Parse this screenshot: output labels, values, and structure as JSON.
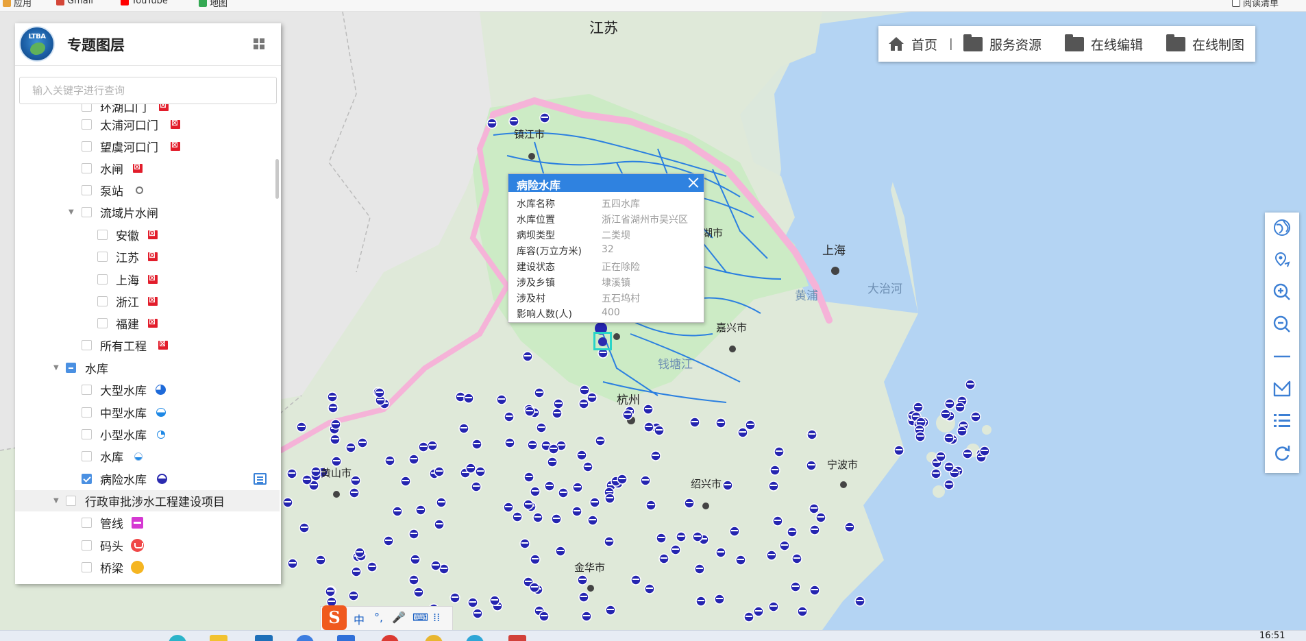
{
  "browser": {
    "bookmarks": [
      "应用",
      "Gmail",
      "YouTube",
      "地图"
    ],
    "right_item": "阅读清单"
  },
  "panel": {
    "title": "专题图层",
    "logo_text": "LTBA",
    "search_placeholder": "输入关键字进行查询",
    "tree": [
      {
        "label": "环湖口门",
        "icon": "gate-icon"
      },
      {
        "label": "太浦河口门",
        "icon": "gate-icon"
      },
      {
        "label": "望虞河口门",
        "icon": "gate-icon"
      },
      {
        "label": "水闸",
        "icon": "gate-icon"
      },
      {
        "label": "泵站",
        "icon": "pump-icon"
      },
      {
        "label": "流域片水闸"
      },
      {
        "label": "安徽",
        "icon": "gate-icon"
      },
      {
        "label": "江苏",
        "icon": "gate-icon"
      },
      {
        "label": "上海",
        "icon": "gate-icon"
      },
      {
        "label": "浙江",
        "icon": "gate-icon"
      },
      {
        "label": "福建",
        "icon": "gate-icon"
      },
      {
        "label": "所有工程",
        "icon": "gate-icon"
      },
      {
        "label": "水库"
      },
      {
        "label": "大型水库",
        "icon": "large-reservoir-icon"
      },
      {
        "label": "中型水库",
        "icon": "medium-reservoir-icon"
      },
      {
        "label": "小型水库",
        "icon": "small-reservoir-icon"
      },
      {
        "label": "水库",
        "icon": "reservoir-icon"
      },
      {
        "label": "病险水库",
        "icon": "dangerous-reservoir-icon",
        "checked": true
      },
      {
        "label": "行政审批涉水工程建设项目"
      },
      {
        "label": "管线",
        "icon": "pipeline-icon"
      },
      {
        "label": "码头",
        "icon": "wharf-icon"
      },
      {
        "label": "桥梁",
        "icon": "bridge-icon"
      }
    ]
  },
  "nav": {
    "home": "首页",
    "separator": "|",
    "services": "服务资源",
    "online_edit": "在线编辑",
    "online_map": "在线制图"
  },
  "popup": {
    "title": "病险水库",
    "rows": [
      {
        "k": "水库名称",
        "v": "五四水库"
      },
      {
        "k": "水库位置",
        "v": "浙江省湖州市吴兴区"
      },
      {
        "k": "病坝类型",
        "v": "二类坝"
      },
      {
        "k": "库容(万立方米)",
        "v": "32"
      },
      {
        "k": "建设状态",
        "v": "正在除险"
      },
      {
        "k": "涉及乡镇",
        "v": "埭溪镇"
      },
      {
        "k": "涉及村",
        "v": "五石坞村"
      },
      {
        "k": "影响人数(人)",
        "v": "400"
      }
    ]
  },
  "map": {
    "labels": {
      "jiangsu": "江苏",
      "zhenjiang": "镇江市",
      "shanghai": "上海",
      "jiaxing": "嘉兴市",
      "hangzhou": "杭州",
      "shaoxing": "绍兴市",
      "ningbo": "宁波市",
      "jinhua": "金华市",
      "huangshan": "黄山市",
      "huzhou": "湖市",
      "dazhihe": "大治河",
      "huangpu": "黄浦",
      "qiantang": "钱塘江"
    },
    "colors": {
      "land": "#dfe9d9",
      "sea": "#b3d3f2",
      "river": "#2a7fe0",
      "boundary": "#f2a6cd",
      "marker": "#2525b0"
    }
  },
  "ime": {
    "logo": "S",
    "keys": [
      "中",
      "°,",
      "🎤",
      "⌨",
      "⁞⁞"
    ]
  },
  "taskbar": {
    "clock": "16:51"
  }
}
